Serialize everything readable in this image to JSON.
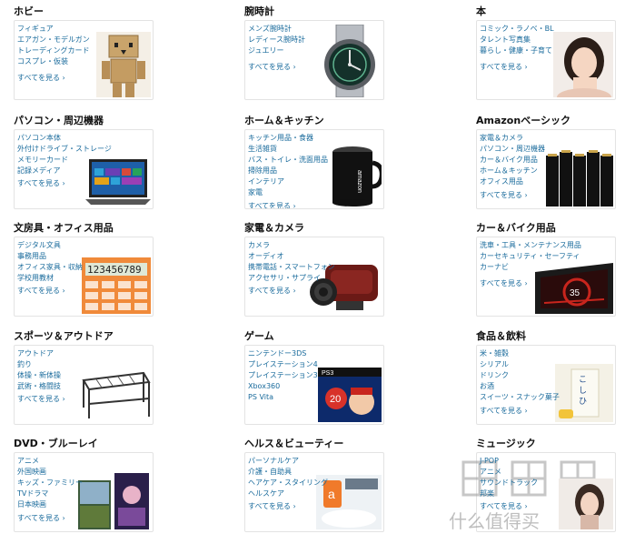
{
  "see_all": "すべてを見る ›",
  "categories": [
    {
      "title": "ホビー",
      "links": [
        "フィギュア",
        "エアガン・モデルガン",
        "トレーディングカード",
        "コスプレ・仮装"
      ],
      "image": "cardboard-robot-figure"
    },
    {
      "title": "腕時計",
      "links": [
        "メンズ腕時計",
        "レディース腕時計",
        "ジュエリー"
      ],
      "image": "wristwatch"
    },
    {
      "title": "本",
      "links": [
        "コミック・ラノベ・BL",
        "タレント写真集",
        "暮らし・健康・子育て"
      ],
      "image": "portrait-photo"
    },
    {
      "title": "パソコン・周辺機器",
      "links": [
        "パソコン本体",
        "外付けドライブ・ストレージ",
        "メモリーカード",
        "記録メディア"
      ],
      "image": "windows-laptop"
    },
    {
      "title": "ホーム＆キッチン",
      "links": [
        "キッチン用品・食器",
        "生活雑貨",
        "バス・トイレ・洗面用品",
        "掃除用品",
        "インテリア",
        "家電"
      ],
      "image": "amazon-mug"
    },
    {
      "title": "Amazonベーシック",
      "links": [
        "家電＆カメラ",
        "パソコン・周辺機器",
        "カー＆バイク用品",
        "ホーム＆キッチン",
        "オフィス用品"
      ],
      "image": "amazon-batteries"
    },
    {
      "title": "文房具・オフィス用品",
      "links": [
        "デジタル文具",
        "事務用品",
        "オフィス家具・収納",
        "学校用教材"
      ],
      "image": "calculator"
    },
    {
      "title": "家電＆カメラ",
      "links": [
        "カメラ",
        "オーディオ",
        "携帯電話・スマートフォン",
        "アクセサリ・サプライ"
      ],
      "image": "video-camera"
    },
    {
      "title": "カー＆バイク用品",
      "links": [
        "洗車・工具・メンテナンス用品",
        "カーセキュリティ・セーフティ",
        "カーナビ"
      ],
      "image": "car-navigation"
    },
    {
      "title": "スポーツ＆アウトドア",
      "links": [
        "アウトドア",
        "釣り",
        "体操・新体操",
        "武術・格闘技"
      ],
      "image": "bbq-grill"
    },
    {
      "title": "ゲーム",
      "links": [
        "ニンテンドー3DS",
        "プレイステーション4",
        "プレイステーション3",
        "Xbox360",
        "PS Vita"
      ],
      "image": "ps3-game-case"
    },
    {
      "title": "食品＆飲料",
      "links": [
        "米・雑穀",
        "シリアル",
        "ドリンク",
        "お酒",
        "スイーツ・スナック菓子"
      ],
      "image": "rice-bag"
    },
    {
      "title": "DVD・ブルーレイ",
      "links": [
        "アニメ",
        "外国映画",
        "キッズ・ファミリー",
        "TVドラマ",
        "日本映画"
      ],
      "image": "dvd-boxes"
    },
    {
      "title": "ヘルス＆ビューティー",
      "links": [
        "パーソナルケア",
        "介護・自助具",
        "ヘアケア・スタイリング",
        "ヘルスケア"
      ],
      "image": "beauty-product"
    },
    {
      "title": "ミュージック",
      "links": [
        "J-POP",
        "アニメ",
        "サウンドトラック",
        "邦楽"
      ],
      "image": "cd-cover"
    }
  ],
  "watermark": "值 什么值得买 zhizhi.com"
}
